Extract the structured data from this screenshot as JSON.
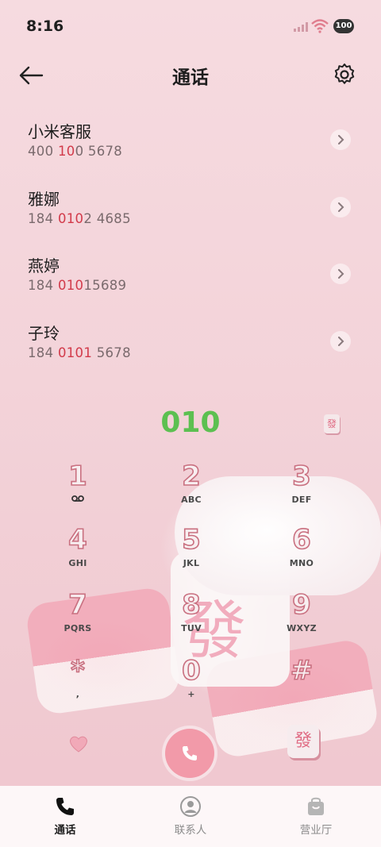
{
  "status_bar": {
    "time": "8:16",
    "battery": "100"
  },
  "header": {
    "title": "通话"
  },
  "contacts": [
    {
      "name": "小米客服",
      "number_parts": [
        "400 ",
        "10",
        "0 5678"
      ],
      "highlight_index": 1
    },
    {
      "name": "雅娜",
      "number_parts": [
        "184 ",
        "010",
        "2 4685"
      ],
      "highlight_index": 1
    },
    {
      "name": "燕婷",
      "number_parts": [
        "184 ",
        "010",
        "15689"
      ],
      "highlight_index": 1
    },
    {
      "name": "子玲",
      "number_parts": [
        "184 ",
        "0101",
        " 5678"
      ],
      "highlight_index": 1
    }
  ],
  "dial_input": "010",
  "keypad": [
    {
      "digit": "1",
      "letters": ""
    },
    {
      "digit": "2",
      "letters": "ABC"
    },
    {
      "digit": "3",
      "letters": "DEF"
    },
    {
      "digit": "4",
      "letters": "GHI"
    },
    {
      "digit": "5",
      "letters": "JKL"
    },
    {
      "digit": "6",
      "letters": "MNO"
    },
    {
      "digit": "7",
      "letters": "PQRS"
    },
    {
      "digit": "8",
      "letters": "TUV"
    },
    {
      "digit": "9",
      "letters": "WXYZ"
    },
    {
      "digit": "*",
      "letters": ","
    },
    {
      "digit": "0",
      "letters": "+"
    },
    {
      "digit": "#",
      "letters": ""
    }
  ],
  "tile_glyph": "發",
  "tabs": [
    {
      "label": "通话",
      "icon": "phone-icon",
      "active": true
    },
    {
      "label": "联系人",
      "icon": "contacts-icon",
      "active": false
    },
    {
      "label": "营业厅",
      "icon": "store-bag-icon",
      "active": false
    }
  ],
  "colors": {
    "accent_green": "#5cc051",
    "highlight_red": "#d23a4a",
    "call_pink": "#f29aa9"
  }
}
